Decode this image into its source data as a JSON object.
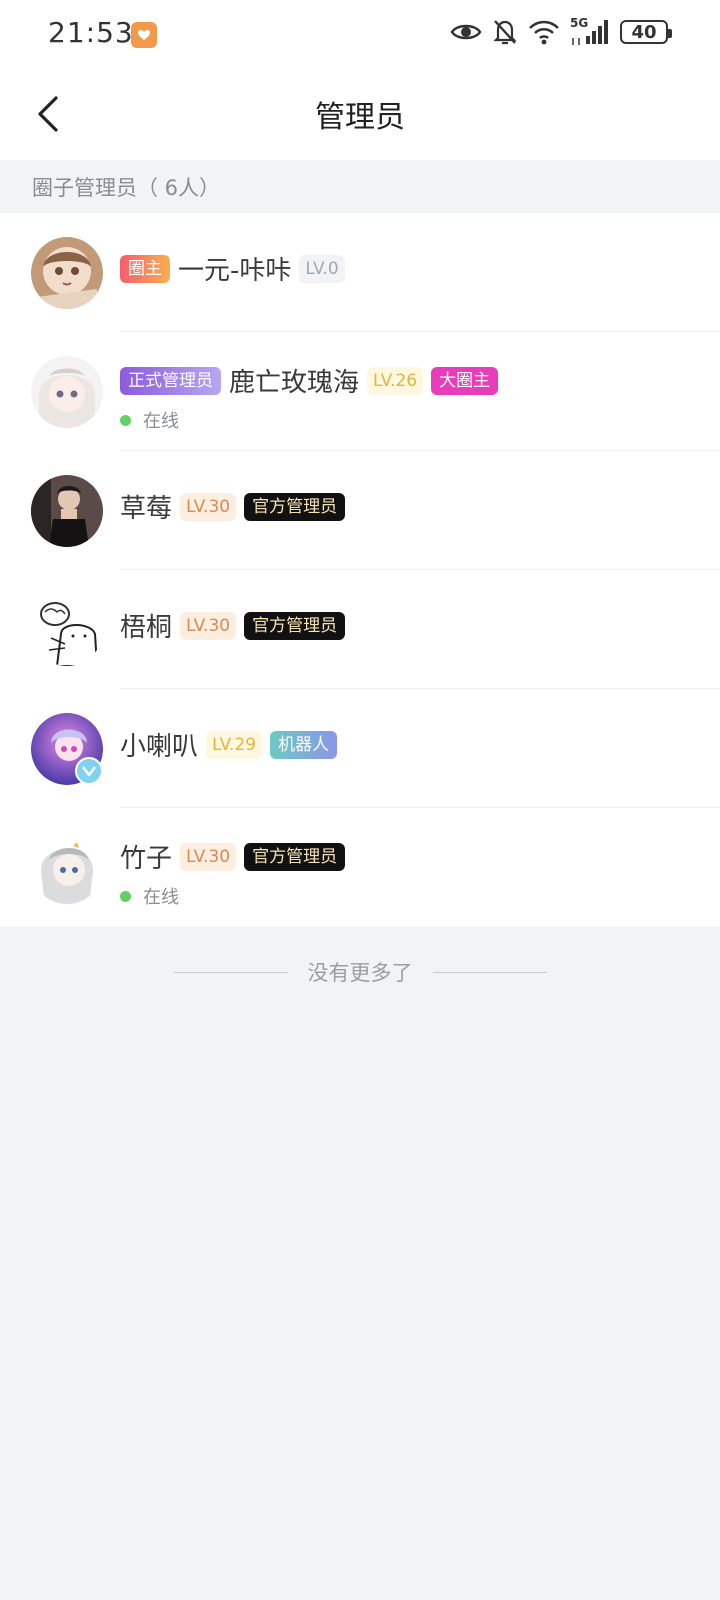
{
  "status_bar": {
    "time": "21:53",
    "battery": "40",
    "network": "5G",
    "icons": [
      "app-notification-icon",
      "eye-icon",
      "bell-muted-icon",
      "wifi-icon",
      "signal-icon",
      "battery-icon"
    ]
  },
  "nav": {
    "title": "管理员",
    "back_icon": "chevron-left-icon"
  },
  "section": {
    "title": "圈子管理员（ 6人）"
  },
  "members": [
    {
      "name": "一元-咔咔",
      "tags_before": [
        "圈主"
      ],
      "level": "LV.0",
      "tags_after": [],
      "online": ""
    },
    {
      "name": "鹿亡玫瑰海",
      "tags_before": [
        "正式管理员"
      ],
      "level": "LV.26",
      "tags_after": [
        "大圈主"
      ],
      "online": "在线"
    },
    {
      "name": "草莓",
      "tags_before": [],
      "level": "LV.30",
      "tags_after": [
        "官方管理员"
      ],
      "online": ""
    },
    {
      "name": "梧桐",
      "tags_before": [],
      "level": "LV.30",
      "tags_after": [
        "官方管理员"
      ],
      "online": ""
    },
    {
      "name": "小喇叭",
      "tags_before": [],
      "level": "LV.29",
      "tags_after": [
        "机器人"
      ],
      "online": ""
    },
    {
      "name": "竹子",
      "tags_before": [],
      "level": "LV.30",
      "tags_after": [
        "官方管理员"
      ],
      "online": "在线"
    }
  ],
  "footer": {
    "end_text": "没有更多了"
  },
  "colors": {
    "background": "#f2f3f7",
    "online_dot": "#63d066",
    "owner_tag": "#f45e6e",
    "admin_tag": "#8c5bdb",
    "official_tag": "#111111",
    "big_owner_tag": "#e83dba"
  }
}
